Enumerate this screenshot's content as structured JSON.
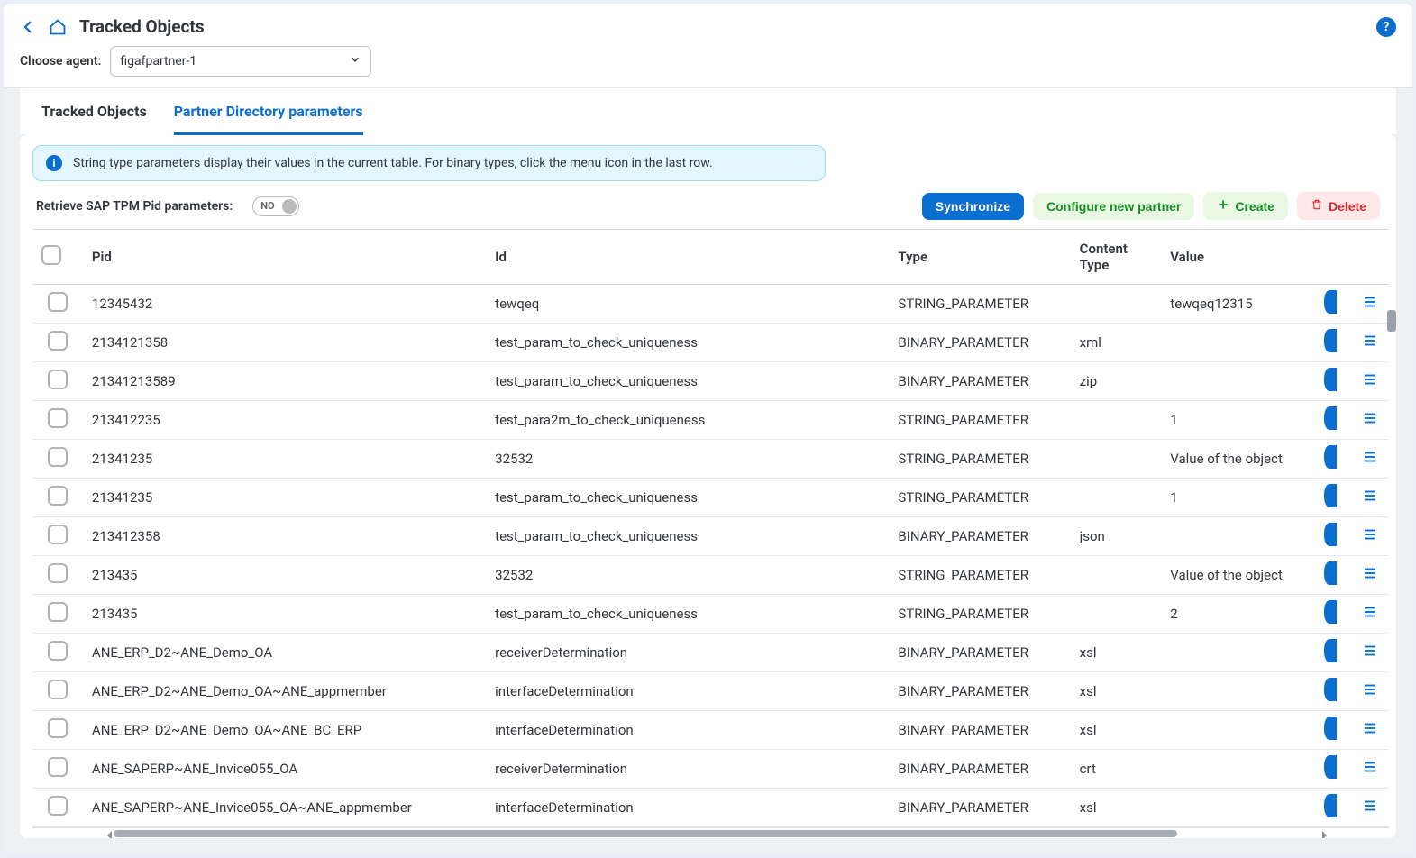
{
  "header": {
    "title": "Tracked Objects"
  },
  "agent": {
    "label": "Choose agent:",
    "selected": "figafpartner-1"
  },
  "tabs": [
    {
      "label": "Tracked Objects",
      "active": false
    },
    {
      "label": "Partner Directory parameters",
      "active": true
    }
  ],
  "info_text": "String type parameters display their values in the current table. For binary types, click the menu icon in the last row.",
  "retrieve_label": "Retrieve SAP TPM Pid parameters:",
  "toggle_text": "NO",
  "actions": {
    "sync": "Synchronize",
    "configure": "Configure new partner",
    "create": "Create",
    "delete": "Delete"
  },
  "columns": {
    "pid": "Pid",
    "id": "Id",
    "type": "Type",
    "ctype": "Content Type",
    "value": "Value"
  },
  "rows": [
    {
      "pid": "12345432",
      "id": "tewqeq",
      "type": "STRING_PARAMETER",
      "ctype": "",
      "value": "tewqeq12315"
    },
    {
      "pid": "2134121358",
      "id": "test_param_to_check_uniqueness",
      "type": "BINARY_PARAMETER",
      "ctype": "xml",
      "value": ""
    },
    {
      "pid": "21341213589",
      "id": "test_param_to_check_uniqueness",
      "type": "BINARY_PARAMETER",
      "ctype": "zip",
      "value": ""
    },
    {
      "pid": "213412235",
      "id": "test_para2m_to_check_uniqueness",
      "type": "STRING_PARAMETER",
      "ctype": "",
      "value": "1"
    },
    {
      "pid": "21341235",
      "id": "32532",
      "type": "STRING_PARAMETER",
      "ctype": "",
      "value": "Value of the object"
    },
    {
      "pid": "21341235",
      "id": "test_param_to_check_uniqueness",
      "type": "STRING_PARAMETER",
      "ctype": "",
      "value": "1"
    },
    {
      "pid": "213412358",
      "id": "test_param_to_check_uniqueness",
      "type": "BINARY_PARAMETER",
      "ctype": "json",
      "value": ""
    },
    {
      "pid": "213435",
      "id": "32532",
      "type": "STRING_PARAMETER",
      "ctype": "",
      "value": "Value of the object"
    },
    {
      "pid": "213435",
      "id": "test_param_to_check_uniqueness",
      "type": "STRING_PARAMETER",
      "ctype": "",
      "value": "2"
    },
    {
      "pid": "ANE_ERP_D2~ANE_Demo_OA",
      "id": "receiverDetermination",
      "type": "BINARY_PARAMETER",
      "ctype": "xsl",
      "value": ""
    },
    {
      "pid": "ANE_ERP_D2~ANE_Demo_OA~ANE_appmember",
      "id": "interfaceDetermination",
      "type": "BINARY_PARAMETER",
      "ctype": "xsl",
      "value": ""
    },
    {
      "pid": "ANE_ERP_D2~ANE_Demo_OA~ANE_BC_ERP",
      "id": "interfaceDetermination",
      "type": "BINARY_PARAMETER",
      "ctype": "xsl",
      "value": ""
    },
    {
      "pid": "ANE_SAPERP~ANE_Invice055_OA",
      "id": "receiverDetermination",
      "type": "BINARY_PARAMETER",
      "ctype": "crt",
      "value": ""
    },
    {
      "pid": "ANE_SAPERP~ANE_Invice055_OA~ANE_appmember",
      "id": "interfaceDetermination",
      "type": "BINARY_PARAMETER",
      "ctype": "xsl",
      "value": ""
    }
  ]
}
